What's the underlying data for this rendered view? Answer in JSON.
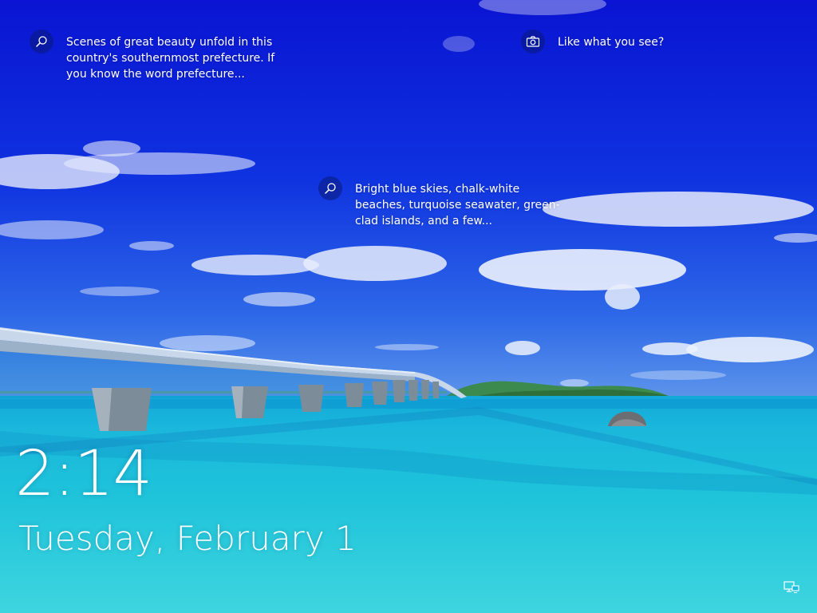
{
  "lockscreen": {
    "hotspots": [
      {
        "icon": "search-icon",
        "text": "Scenes of great beauty unfold in this country's southernmost prefecture. If you know the word prefecture..."
      },
      {
        "icon": "camera-icon",
        "text": "Like what you see?"
      },
      {
        "icon": "search-icon",
        "text": "Bright blue skies, chalk-white beaches, turquoise seawater, green-clad islands, and a few..."
      }
    ],
    "clock": {
      "time": "2:14",
      "date": "Tuesday, February 1"
    },
    "status_icons": [
      "network-icon"
    ]
  },
  "colors": {
    "sky_top": "#0a1ad6",
    "sky_bottom": "#3f7fe8",
    "sea": "#20c6de",
    "text": "#ffffff"
  }
}
